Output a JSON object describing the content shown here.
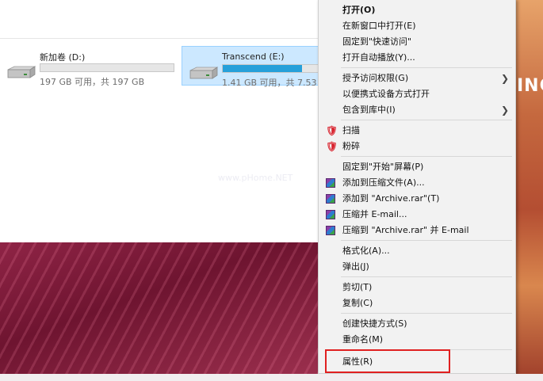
{
  "wallpaper_text": "INC",
  "watermark": "www.pHome.NET",
  "drives": [
    {
      "name": "新加卷 (D:)",
      "size_text": "197 GB 可用，共 197 GB",
      "used_fraction": 0.0,
      "selected": false
    },
    {
      "name": "Transcend (E:)",
      "size_text": "1.41 GB 可用，共 7.53 GB",
      "used_fraction": 0.81,
      "selected": true
    }
  ],
  "context_menu": {
    "items": [
      {
        "label": "打开(O)"
      },
      {
        "label": "在新窗口中打开(E)"
      },
      {
        "label": "固定到\"快速访问\""
      },
      {
        "label": "打开自动播放(Y)..."
      },
      {
        "label": "授予访问权限(G)"
      },
      {
        "label": "以便携式设备方式打开"
      },
      {
        "label": "包含到库中(I)"
      },
      {
        "label": "扫描"
      },
      {
        "label": "粉碎"
      },
      {
        "label": "固定到\"开始\"屏幕(P)"
      },
      {
        "label": "添加到压缩文件(A)..."
      },
      {
        "label": "添加到 \"Archive.rar\"(T)"
      },
      {
        "label": "压缩并 E-mail..."
      },
      {
        "label": "压缩到 \"Archive.rar\" 并 E-mail"
      },
      {
        "label": "格式化(A)..."
      },
      {
        "label": "弹出(J)"
      },
      {
        "label": "剪切(T)"
      },
      {
        "label": "复制(C)"
      },
      {
        "label": "创建快捷方式(S)"
      },
      {
        "label": "重命名(M)"
      },
      {
        "label": "属性(R)"
      }
    ],
    "highlight_color": "#e02020"
  }
}
